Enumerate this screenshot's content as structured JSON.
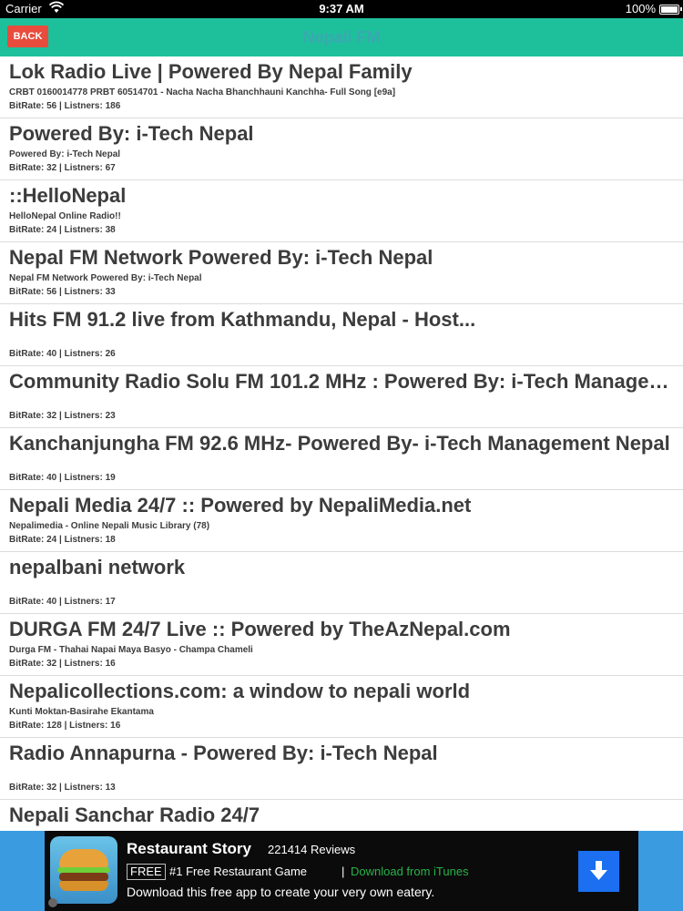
{
  "status_bar": {
    "carrier": "Carrier",
    "time": "9:37 AM",
    "battery": "100%"
  },
  "nav": {
    "back_label": "BACK",
    "title": "Nepali FM"
  },
  "stations": [
    {
      "title": "Lok Radio Live | Powered By Nepal Family",
      "desc": "CRBT 0160014778 PRBT 60514701 - Nacha Nacha Bhanchhauni Kanchha- Full Song [e9a]",
      "stats": "BitRate: 56 | Listners: 186"
    },
    {
      "title": "Powered By: i-Tech Nepal",
      "desc": "Powered By: i-Tech Nepal",
      "stats": "BitRate: 32 | Listners: 67"
    },
    {
      "title": "::HelloNepal",
      "desc": "HelloNepal Online Radio!!",
      "stats": "BitRate: 24 | Listners: 38"
    },
    {
      "title": "Nepal FM Network Powered By: i-Tech Nepal",
      "desc": "Nepal FM Network Powered By: i-Tech Nepal",
      "stats": "BitRate: 56 | Listners: 33"
    },
    {
      "title": "Hits FM 91.2 live from Kathmandu, Nepal - Host...",
      "desc": "",
      "stats": "BitRate: 40 | Listners: 26"
    },
    {
      "title": "Community Radio Solu FM 101.2 MHz : Powered By: i-Tech Manageme...",
      "desc": "",
      "stats": "BitRate: 32 | Listners: 23"
    },
    {
      "title": "Kanchanjungha FM 92.6 MHz- Powered By- i-Tech Management Nepal",
      "desc": "",
      "stats": "BitRate: 40 | Listners: 19"
    },
    {
      "title": "Nepali Media 24/7 :: Powered by NepaliMedia.net",
      "desc": "Nepalimedia - Online Nepali Music Library (78)",
      "stats": "BitRate: 24 | Listners: 18"
    },
    {
      "title": "nepalbani network",
      "desc": "",
      "stats": "BitRate: 40 | Listners: 17"
    },
    {
      "title": "DURGA FM 24/7 Live :: Powered by TheAzNepal.com",
      "desc": "Durga FM - Thahai Napai Maya Basyo - Champa Chameli",
      "stats": "BitRate: 32 | Listners: 16"
    },
    {
      "title": "Nepalicollections.com: a window to nepali world",
      "desc": "Kunti Moktan-Basirahe Ekantama",
      "stats": "BitRate: 128 | Listners: 16"
    },
    {
      "title": "Radio Annapurna - Powered By: i-Tech Nepal",
      "desc": "",
      "stats": "BitRate: 32 | Listners: 13"
    },
    {
      "title": "Nepali Sanchar Radio 24/7",
      "desc": "",
      "stats": ""
    }
  ],
  "ad": {
    "title": "Restaurant Story",
    "reviews": "221414 Reviews",
    "free_badge": "FREE",
    "tagline": "#1 Free Restaurant Game",
    "separator": "|",
    "download_link": "Download from iTunes",
    "description": "Download this free app to create your very own eatery."
  },
  "colors": {
    "nav_bar": "#1ec09c",
    "back_button": "#e84c3d",
    "ad_background": "#3a9be0",
    "download_button": "#1b6ff0"
  }
}
